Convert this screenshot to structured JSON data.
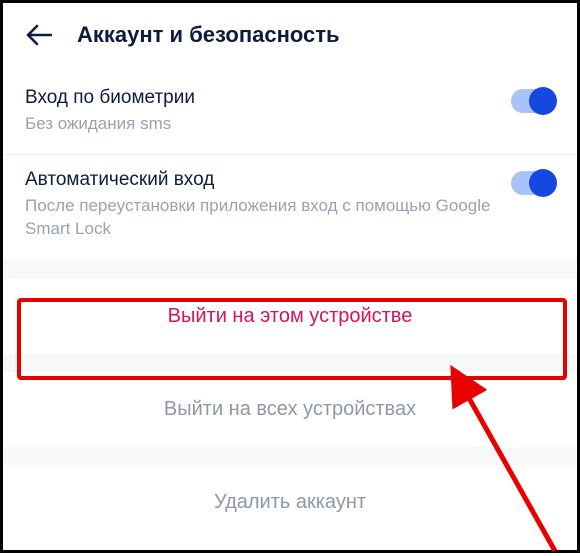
{
  "header": {
    "title": "Аккаунт и безопасность"
  },
  "settings": {
    "biometric": {
      "title": "Вход по биометрии",
      "subtitle": "Без ожидания sms",
      "enabled": true
    },
    "autologin": {
      "title": "Автоматический вход",
      "subtitle": "После переустановки приложения вход с помощью Google Smart Lock",
      "enabled": true
    }
  },
  "actions": {
    "logout_this": "Выйти на этом устройстве",
    "logout_all": "Выйти на всех устройствах",
    "delete": "Удалить аккаунт"
  },
  "annotation": {
    "highlight_target": "logout_this",
    "arrow_color": "#e80000"
  }
}
